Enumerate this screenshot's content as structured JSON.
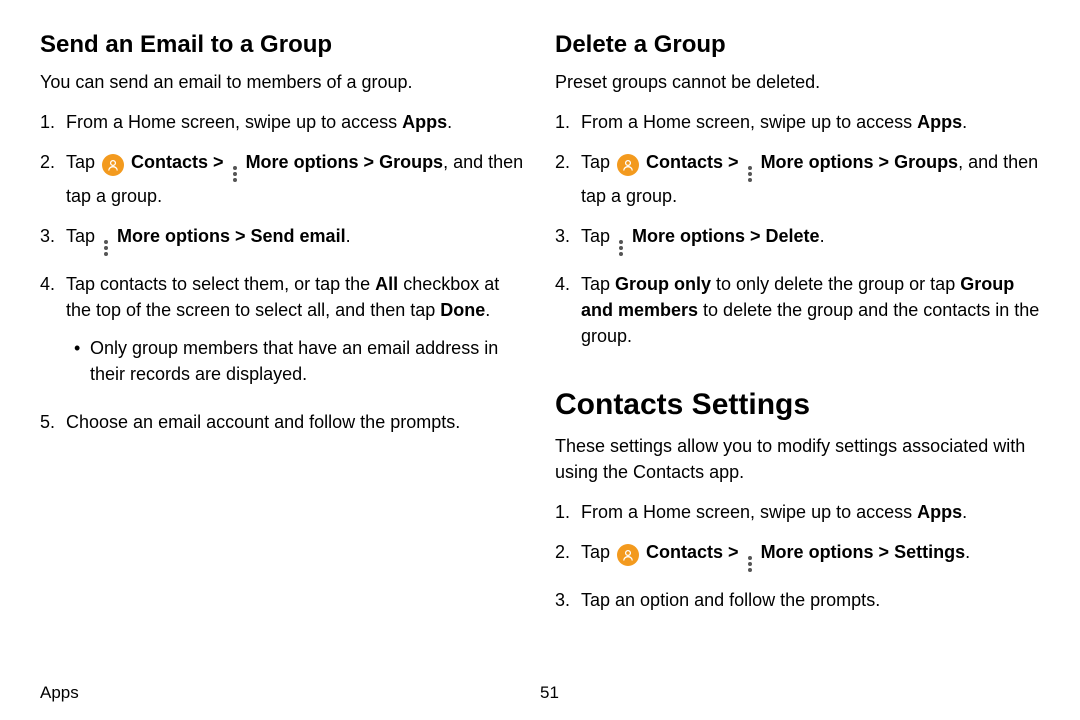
{
  "left": {
    "heading": "Send an Email to a Group",
    "desc": "You can send an email to members of a group.",
    "step1_pre": "From a Home screen, swipe up to access ",
    "step1_b": "Apps",
    "step1_post": ".",
    "step2_pre": "Tap ",
    "step2_contacts": " Contacts > ",
    "step2_more": " More options > Groups",
    "step2_post": ", and then tap a group.",
    "step3_pre": "Tap ",
    "step3_b": " More options > Send email",
    "step3_post": ".",
    "step4_a": "Tap contacts to select them, or tap the ",
    "step4_all": "All",
    "step4_b": " checkbox at the top of the screen to select all, and then tap ",
    "step4_done": "Done",
    "step4_post": ".",
    "step4_bullet": "Only group members that have an email address in their records are displayed.",
    "step5": "Choose an email account and follow the prompts."
  },
  "right": {
    "heading": "Delete a Group",
    "desc": "Preset groups cannot be deleted.",
    "step1_pre": "From a Home screen, swipe up to access ",
    "step1_b": "Apps",
    "step1_post": ".",
    "step2_pre": "Tap ",
    "step2_contacts": " Contacts > ",
    "step2_more": " More options > Groups",
    "step2_post": ", and then tap a group.",
    "step3_pre": "Tap ",
    "step3_b": " More options > Delete",
    "step3_post": ".",
    "step4_a": "Tap ",
    "step4_go": "Group only",
    "step4_b": " to only delete the group or tap ",
    "step4_gm": "Group and members",
    "step4_c": " to delete the group and the contacts in the group.",
    "settings_heading": "Contacts Settings",
    "settings_desc": "These settings allow you to modify settings associated with using the Contacts app.",
    "s_step1_pre": "From a Home screen, swipe up to access ",
    "s_step1_b": "Apps",
    "s_step1_post": ".",
    "s_step2_pre": "Tap ",
    "s_step2_contacts": " Contacts > ",
    "s_step2_more": " More options > Settings",
    "s_step2_post": ".",
    "s_step3": "Tap an option and follow the prompts."
  },
  "footer": {
    "section": "Apps",
    "page": "51"
  },
  "nums": {
    "n1": "1.",
    "n2": "2.",
    "n3": "3.",
    "n4": "4.",
    "n5": "5.",
    "bullet": "•"
  }
}
